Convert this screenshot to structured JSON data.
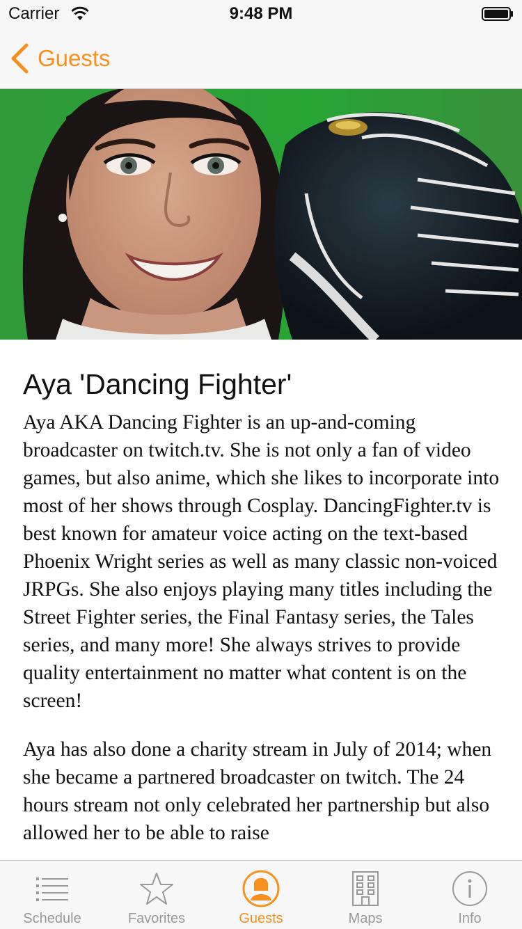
{
  "status_bar": {
    "carrier": "Carrier",
    "time": "9:48 PM"
  },
  "nav": {
    "back_label": "Guests"
  },
  "guest": {
    "name": "Aya 'Dancing Fighter'",
    "bio_paragraphs": [
      "Aya AKA Dancing Fighter is an up-and-coming broadcaster on twitch.tv. She is not only a fan of video games, but also anime, which she likes to incorporate into most of her shows through Cosplay. DancingFighter.tv is best known for amateur voice acting on the text-based Phoenix Wright series as well as many classic non-voiced JRPGs. She also enjoys playing many titles including the Street Fighter series, the Final Fantasy series, the Tales series, and many more! She always strives to provide quality entertainment no matter what content is on the screen!",
      "Aya has also done a charity stream in July of 2014; when she became a partnered broadcaster on twitch. The 24 hours stream not only celebrated her partnership but also allowed her to be able to raise"
    ]
  },
  "tabs": [
    {
      "label": "Schedule",
      "icon": "list-icon",
      "active": false
    },
    {
      "label": "Favorites",
      "icon": "star-icon",
      "active": false
    },
    {
      "label": "Guests",
      "icon": "person-icon",
      "active": true
    },
    {
      "label": "Maps",
      "icon": "building-icon",
      "active": false
    },
    {
      "label": "Info",
      "icon": "info-icon",
      "active": false
    }
  ],
  "colors": {
    "accent": "#f7901e",
    "tab_inactive": "#999999",
    "bar_background": "#f7f7f7",
    "hero_background": "#2a9a35"
  }
}
